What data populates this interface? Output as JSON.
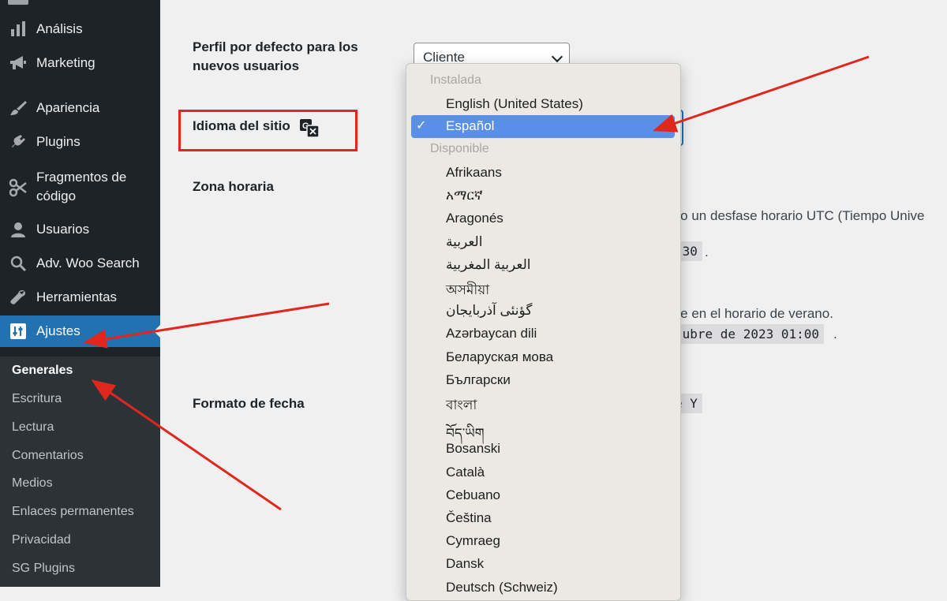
{
  "sidebar": {
    "items": [
      {
        "label": "Análisis",
        "icon": "bar-chart-icon"
      },
      {
        "label": "Marketing",
        "icon": "megaphone-icon"
      },
      {
        "label": "Apariencia",
        "icon": "paintbrush-icon"
      },
      {
        "label": "Plugins",
        "icon": "plug-icon"
      },
      {
        "label": "Fragmentos de código",
        "icon": "scissors-icon"
      },
      {
        "label": "Usuarios",
        "icon": "user-icon"
      },
      {
        "label": "Adv. Woo Search",
        "icon": "search-icon"
      },
      {
        "label": "Herramientas",
        "icon": "wrench-icon"
      },
      {
        "label": "Ajustes",
        "icon": "settings-sliders-icon"
      }
    ],
    "submenu": [
      "Generales",
      "Escritura",
      "Lectura",
      "Comentarios",
      "Medios",
      "Enlaces permanentes",
      "Privacidad",
      "SG Plugins"
    ],
    "current_submenu": "Generales"
  },
  "settings": {
    "default_role_label": "Perfil por defecto para los nuevos usuarios",
    "default_role_line1": "Perfil por defecto para los",
    "default_role_line2": "nuevos usuarios",
    "default_role_value": "Cliente",
    "site_language_label": "Idioma del sitio",
    "timezone_label": "Zona horaria",
    "date_format_label": "Formato de fecha",
    "timezone_desc": "a o un desfase horario UTC (Tiempo Unive",
    "utc_time_fragment": ":30",
    "period_1": ".",
    "period_2": ".",
    "dst_text": "nte en el horario de verano.",
    "dst_date_fragment": "tubre de 2023 01:00",
    "period_3": ".",
    "date_format_fragment": "e Y"
  },
  "language_dropdown": {
    "group_installed": "Instalada",
    "installed": [
      "English (United States)",
      "Español"
    ],
    "selected": "Español",
    "group_available": "Disponible",
    "available": [
      "Afrikaans",
      "አማርኛ",
      "Aragonés",
      "العربية",
      "العربية المغربية",
      "অসমীয়া",
      "گؤنئی آذربایجان",
      "Azərbaycan dili",
      "Беларуская мова",
      "Български",
      "বাংলা",
      "བོད་ཡིག",
      "Bosanski",
      "Català",
      "Cebuano",
      "Čeština",
      "Cymraeg",
      "Dansk",
      "Deutsch (Schweiz)"
    ]
  },
  "colors": {
    "sidebar_bg": "#1d2327",
    "active_blue": "#2271b1",
    "selection_blue": "#5a8fe8",
    "annotation_red": "#e0261d"
  }
}
